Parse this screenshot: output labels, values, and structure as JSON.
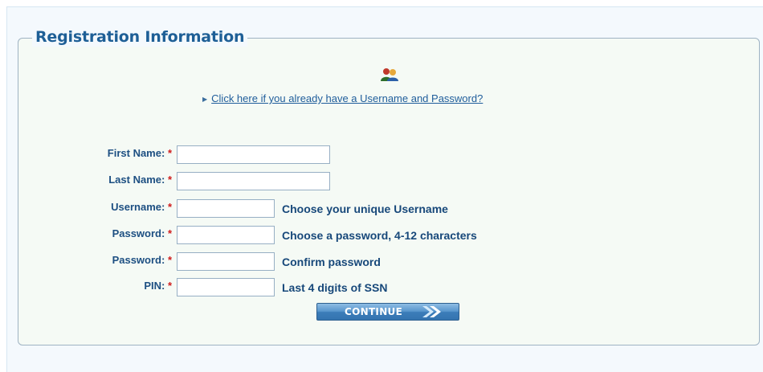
{
  "section": {
    "title": "Registration Information",
    "icon": "people-icon",
    "login_link": "Click here if you already have a Username and Password?"
  },
  "form": {
    "required_marker": "*",
    "fields": [
      {
        "label": "First Name:",
        "value": "",
        "hint": ""
      },
      {
        "label": "Last Name:",
        "value": "",
        "hint": ""
      },
      {
        "label": "Username:",
        "value": "",
        "hint": "Choose your unique Username"
      },
      {
        "label": "Password:",
        "value": "",
        "hint": "Choose a password, 4-12 characters"
      },
      {
        "label": "Password:",
        "value": "",
        "hint": "Confirm password"
      },
      {
        "label": "PIN:",
        "value": "",
        "hint": "Last 4 digits of SSN"
      }
    ],
    "continue_label": "CONTINUE"
  },
  "colors": {
    "heading": "#1e5f96",
    "label": "#1d4f82",
    "required": "#d01b1b",
    "button": "#3c7db9"
  }
}
